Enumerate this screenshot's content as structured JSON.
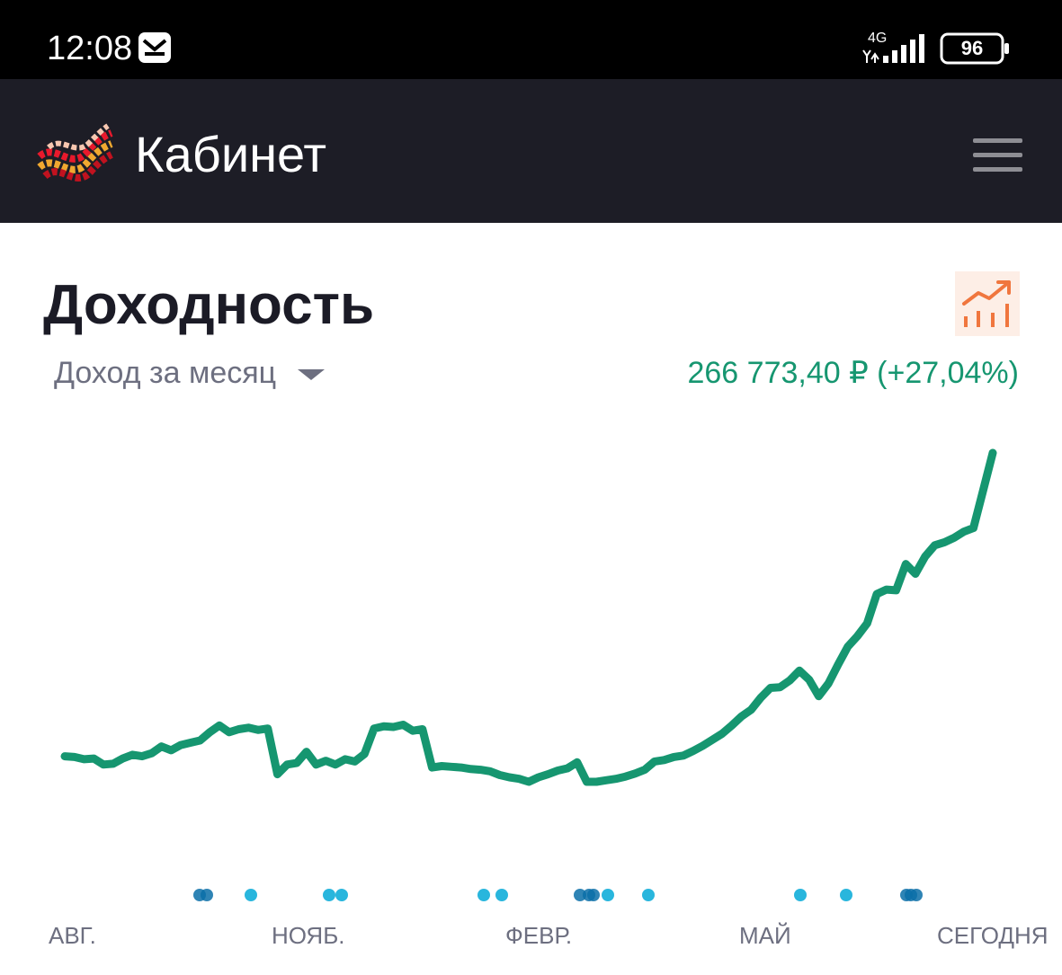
{
  "status_bar": {
    "time": "12:08",
    "network": "4G",
    "battery": "96",
    "icons": [
      "mail-icon",
      "signal-icon",
      "battery-icon"
    ]
  },
  "header": {
    "title": "Кабинет",
    "logo": "logo-icon",
    "menu_icon": "hamburger-menu-icon"
  },
  "main": {
    "section_title": "Доходность",
    "period_select": {
      "selected": "Доход за месяц",
      "icon": "caret-down-icon"
    },
    "income": "266 773,40 ₽ (+27,04%)",
    "analytics_icon": "chart-trend-icon",
    "colors": {
      "accent": "#169670",
      "event_marker": "#29b6dd",
      "event_marker_dense": "#0b6fa8",
      "analytics_icon": "#f0763e"
    }
  },
  "chart_data": {
    "type": "line",
    "x_tick_labels": [
      "АВГ.",
      "НОЯБ.",
      "ФЕВР.",
      "МАЙ",
      "СЕГОДНЯ"
    ],
    "values": [
      23.2,
      23.1,
      22.8,
      22.9,
      22.1,
      22.2,
      22.9,
      23.4,
      23.2,
      23.6,
      24.5,
      24,
      24.7,
      25,
      25.3,
      26.4,
      27.3,
      26.4,
      26.8,
      27,
      26.7,
      26.9,
      20.8,
      22.1,
      22.3,
      23.8,
      22.1,
      22.6,
      22.1,
      22.8,
      22.5,
      23.5,
      26.9,
      27.2,
      27.1,
      27.4,
      26.6,
      26.8,
      21.7,
      21.9,
      21.8,
      21.7,
      21.5,
      21.4,
      21.2,
      20.7,
      20.4,
      20.2,
      19.8,
      20.4,
      20.8,
      21.3,
      21.6,
      22.4,
      19.8,
      19.8,
      20,
      20.2,
      20.5,
      20.9,
      21.4,
      22.5,
      22.7,
      23.1,
      23.3,
      23.9,
      24.6,
      25.4,
      26.2,
      27.3,
      28.5,
      29.4,
      31,
      32.3,
      32.4,
      33.3,
      34.6,
      33.4,
      31.2,
      32.9,
      35.4,
      37.8,
      39.2,
      40.9,
      44.8,
      45.4,
      45.3,
      48.8,
      47.5,
      49.8,
      51.3,
      51.7,
      52.3,
      53.1,
      53.6,
      58.6,
      63.6
    ],
    "series_color": "#169670",
    "event_markers": [
      "Сен",
      "Сен",
      "Окт",
      "Нояб",
      "Нояб",
      "Янв",
      "Янв",
      "Фев",
      "Фев",
      "Фев",
      "Фев",
      "Мар",
      "Май",
      "Июн",
      "Июл",
      "Июл",
      "Июл"
    ],
    "grid": false,
    "legend": "none"
  }
}
